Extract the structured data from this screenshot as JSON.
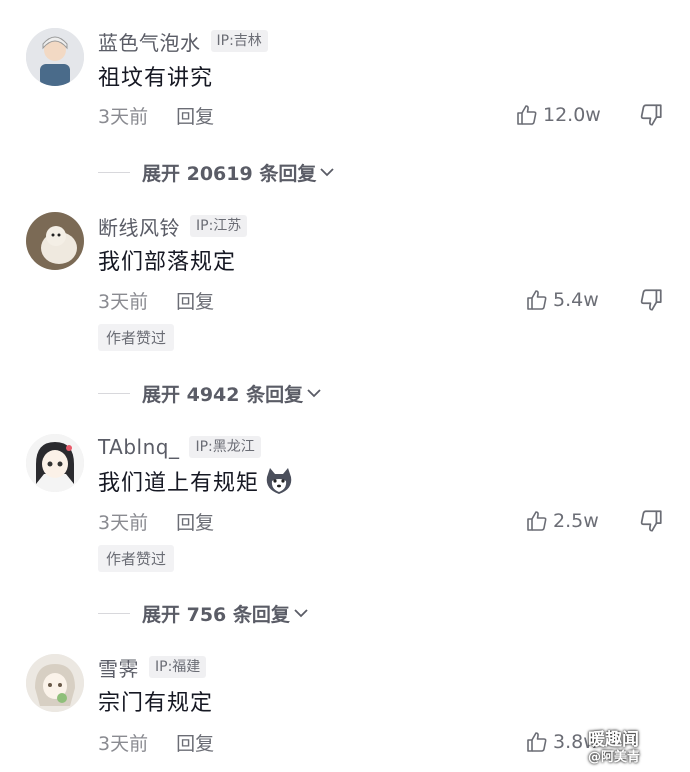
{
  "comments": [
    {
      "username": "蓝色气泡水",
      "ip": "IP:吉林",
      "text": "祖坟有讲究",
      "time": "3天前",
      "reply_label": "回复",
      "likes": "12.0w",
      "expand_label": "展开 20619 条回复"
    },
    {
      "username": "断线风铃",
      "ip": "IP:江苏",
      "text": "我们部落规定",
      "time": "3天前",
      "reply_label": "回复",
      "likes": "5.4w",
      "author_tag": "作者赞过",
      "expand_label": "展开 4942 条回复"
    },
    {
      "username": "TAblnq_",
      "ip": "IP:黑龙江",
      "text": "我们道上有规矩",
      "emoji": "husky-emoji",
      "time": "3天前",
      "reply_label": "回复",
      "likes": "2.5w",
      "author_tag": "作者赞过",
      "expand_label": "展开 756 条回复"
    },
    {
      "username": "雪霁",
      "ip": "IP:福建",
      "text": "宗门有规定",
      "time": "3天前",
      "reply_label": "回复",
      "likes": "3.8w"
    }
  ],
  "icons": {
    "like": "thumbs-up-icon",
    "dislike": "thumbs-down-icon",
    "expand": "chevron-down-icon"
  },
  "watermark": {
    "title": "暖趣闻",
    "sub": "@阿美青"
  }
}
